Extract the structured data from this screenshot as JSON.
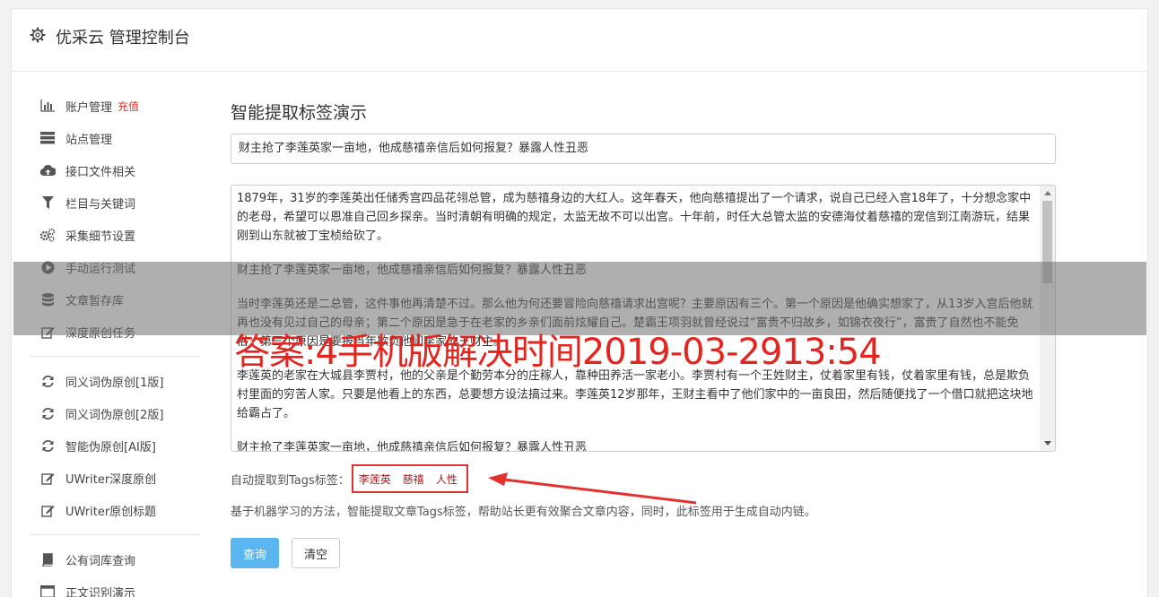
{
  "header": {
    "title": "优采云 管理控制台",
    "icon": "gear-icon"
  },
  "sidebar": {
    "groups": [
      [
        {
          "label": "账户管理",
          "badge": "充值",
          "icon": "bar-chart-icon"
        },
        {
          "label": "站点管理",
          "icon": "server-icon"
        },
        {
          "label": "接口文件相关",
          "icon": "cloud-upload-icon"
        },
        {
          "label": "栏目与关键词",
          "icon": "filter-icon"
        },
        {
          "label": "采集细节设置",
          "icon": "cogs-icon"
        },
        {
          "label": "手动运行测试",
          "icon": "play-circle-icon"
        },
        {
          "label": "文章暂存库",
          "icon": "database-icon"
        },
        {
          "label": "深度原创任务",
          "icon": "edit-icon"
        }
      ],
      [
        {
          "label": "同义词伪原创[1版]",
          "icon": "refresh-icon"
        },
        {
          "label": "同义词伪原创[2版]",
          "icon": "refresh-icon"
        },
        {
          "label": "智能伪原创[AI版]",
          "icon": "refresh-icon"
        },
        {
          "label": "UWriter深度原创",
          "icon": "edit-icon"
        },
        {
          "label": "UWriter原创标题",
          "icon": "edit-icon"
        }
      ],
      [
        {
          "label": "公有词库查询",
          "icon": "book-icon"
        },
        {
          "label": "正文识别演示",
          "icon": "window-icon"
        }
      ]
    ]
  },
  "main": {
    "title": "智能提取标签演示",
    "title_input_value": "财主抢了李莲英家一亩地，他成慈禧亲信后如何报复？暴露人性丑恶",
    "content_paragraphs": [
      "1879年，31岁的李莲英出任储秀宫四品花翎总管，成为慈禧身边的大红人。这年春天，他向慈禧提出了一个请求，说自己已经入宫18年了，十分想念家中的老母，希望可以恩准自己回乡探亲。当时清朝有明确的规定，太监无故不可以出宫。十年前，时任大总管太监的安德海仗着慈禧的宠信到江南游玩，结果刚到山东就被丁宝桢给砍了。",
      "财主抢了李莲英家一亩地，他成慈禧亲信后如何报复？暴露人性丑恶",
      "当时李莲英还是二总管，这件事他再清楚不过。那么他为何还要冒险向慈禧请求出宫呢？主要原因有三个。第一个原因是他确实想家了，从13岁入宫后他就再也没有见过自己的母亲；第二个原因是急于在老家的乡亲们面前炫耀自己。楚霸王项羽就曾经说过“富贵不归故乡，如锦衣夜行”，富贵了自然也不能免俗；第三个原因是要报当年欺负他们李家的王财主。",
      "李莲英的老家在大城县李贾村，他的父亲是个勤劳本分的庄稼人，靠种田养活一家老小。李贾村有一个王姓财主，仗着家里有钱，仗着家里有钱，总是欺负村里面的穷苦人家。只要是他看上的东西，总要想方设法搞过来。李莲英12岁那年，王财主看中了他们家中的一亩良田，然后随便找了一个借口就把这块地给霸占了。",
      "财主抢了李莲英家一亩地，他成慈禧亲信后如何报复？暴露人性丑恶"
    ],
    "tags_label": "自动提取到Tags标签：",
    "tags": [
      "李莲英",
      "慈禧",
      "人性"
    ],
    "description": "基于机器学习的方法，智能提取文章Tags标签，帮助站长更有效聚合文章内容，同时，此标签用于生成自动内链。",
    "query_button": "查询",
    "clear_button": "清空"
  },
  "overlay": {
    "watermark": "答案:4手机版解决时间2019-03-2913:54"
  },
  "colors": {
    "accent": "#5bb5ef",
    "highlight": "#e3322e",
    "tag": "#a8181e",
    "badge": "#d9332b"
  }
}
